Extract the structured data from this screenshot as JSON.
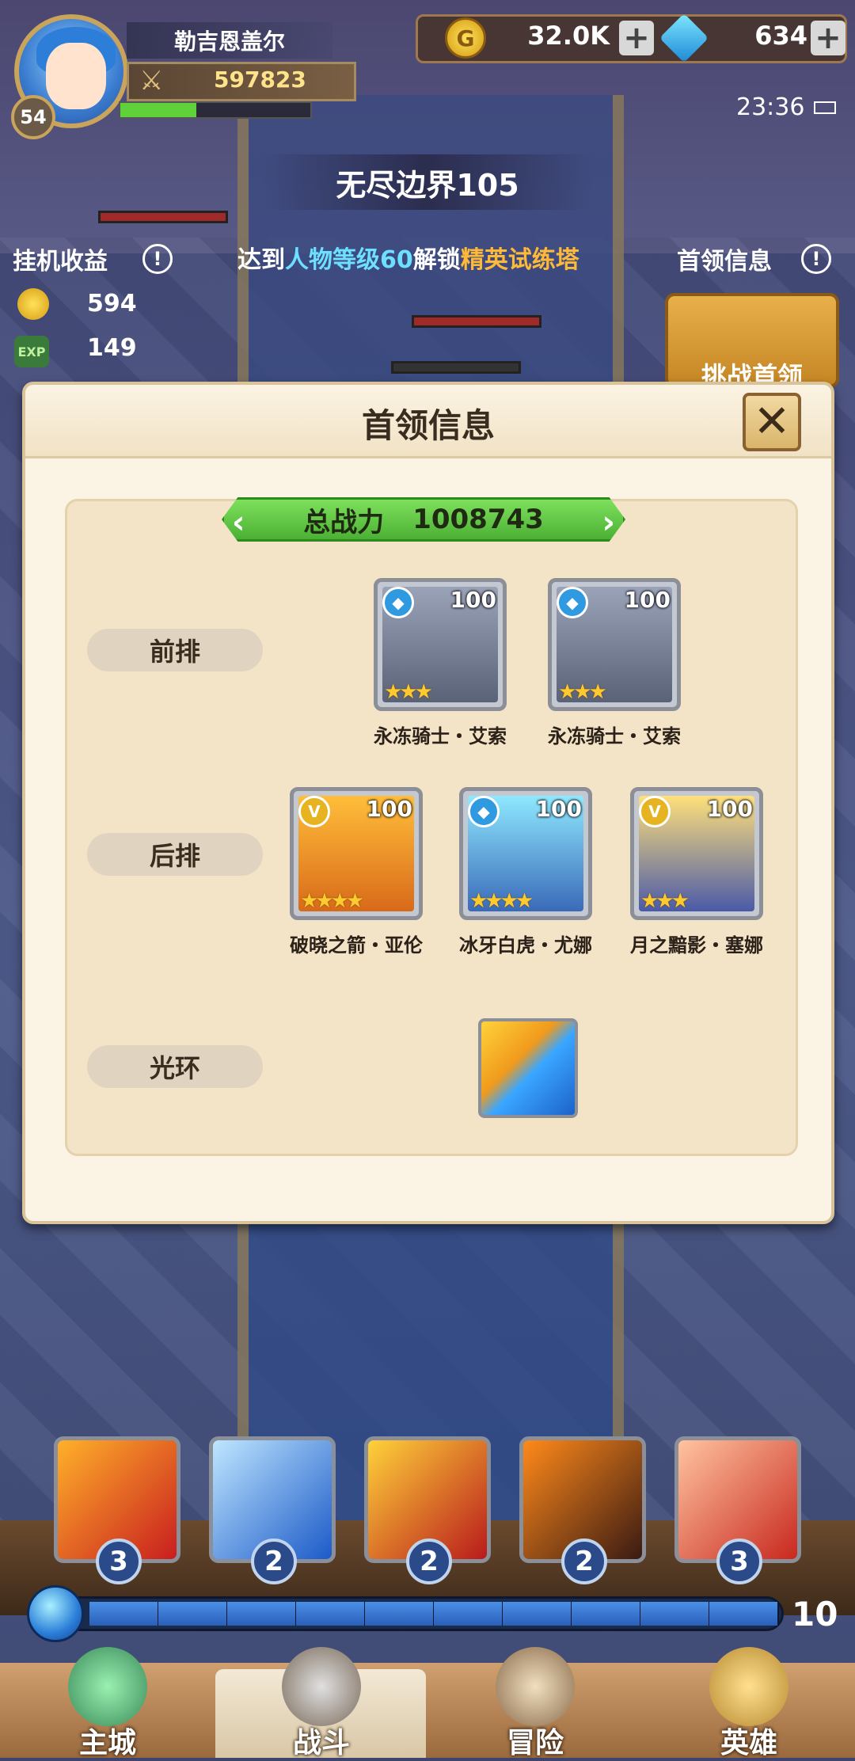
{
  "player": {
    "name": "勒吉恩盖尔",
    "level": "54",
    "power": "597823",
    "exp_progress": 0.4
  },
  "resources": {
    "gold": "32.0K",
    "gems": "634"
  },
  "status": {
    "clock": "23:36"
  },
  "stage": {
    "title": "无尽边界105"
  },
  "idle_income": {
    "title": "挂机收益",
    "gold": "594",
    "exp": "149",
    "exp_label": "EXP"
  },
  "unlock_tip": {
    "prefix": "达到",
    "req": "人物等级60",
    "mid": "解锁",
    "target": "精英试练塔"
  },
  "boss_info_label": "首领信息",
  "challenge_label": "挑战首领",
  "modal": {
    "title": "首领信息",
    "total_power_label": "总战力",
    "total_power": "1008743",
    "rows": {
      "front": "前排",
      "back": "后排",
      "aura": "光环"
    },
    "front": [
      {
        "name": "永冻骑士・艾索",
        "level": "100",
        "stars": 3,
        "type": "blue"
      },
      {
        "name": "永冻骑士・艾索",
        "level": "100",
        "stars": 3,
        "type": "blue"
      }
    ],
    "back": [
      {
        "name": "破晓之箭・亚伦",
        "level": "100",
        "stars": 4,
        "type": "gold"
      },
      {
        "name": "冰牙白虎・尤娜",
        "level": "100",
        "stars": 4,
        "type": "blue"
      },
      {
        "name": "月之黯影・塞娜",
        "level": "100",
        "stars": 3,
        "type": "gold"
      }
    ]
  },
  "skills": [
    {
      "name": "flame-sword",
      "count": "3"
    },
    {
      "name": "ice-lance",
      "count": "2"
    },
    {
      "name": "bomb",
      "count": "2"
    },
    {
      "name": "shadow",
      "count": "2"
    },
    {
      "name": "fire-slash",
      "count": "3"
    }
  ],
  "energy": {
    "count": "10",
    "segments": 10
  },
  "nav": {
    "home": "主城",
    "battle": "战斗",
    "adventure": "冒险",
    "heroes": "英雄"
  },
  "colors": {
    "accent_green": "#5fd13a",
    "title_brown": "#3a2d20",
    "unlock_blue": "#6ee0ff",
    "unlock_orange": "#ffb938"
  }
}
